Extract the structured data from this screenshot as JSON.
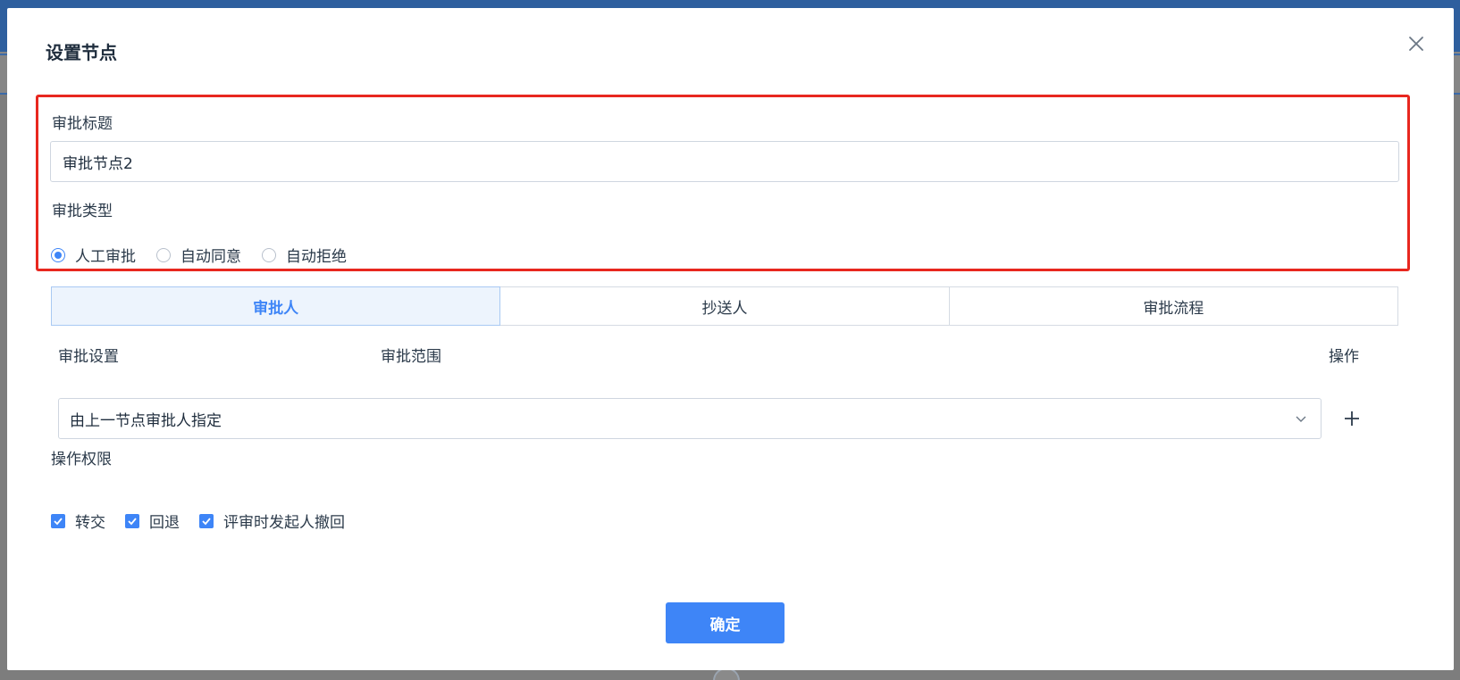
{
  "modal": {
    "title": "设置节点",
    "approval_title_label": "审批标题",
    "approval_title_value": "审批节点2",
    "approval_type_label": "审批类型",
    "approval_types": [
      {
        "label": "人工审批",
        "checked": true
      },
      {
        "label": "自动同意",
        "checked": false
      },
      {
        "label": "自动拒绝",
        "checked": false
      }
    ],
    "tabs": [
      {
        "label": "审批人",
        "active": true
      },
      {
        "label": "抄送人",
        "active": false
      },
      {
        "label": "审批流程",
        "active": false
      }
    ],
    "table_headers": {
      "setting": "审批设置",
      "scope": "审批范围",
      "action": "操作"
    },
    "approver_setting_value": "由上一节点审批人指定",
    "permissions_label": "操作权限",
    "permissions": [
      {
        "label": "转交",
        "checked": true
      },
      {
        "label": "回退",
        "checked": true
      },
      {
        "label": "评审时发起人撤回",
        "checked": true
      }
    ],
    "confirm_label": "确定"
  },
  "colors": {
    "accent": "#3e85f7",
    "highlight": "#e8271f"
  },
  "icons": {
    "close": "close-icon",
    "chevron": "chevron-down-icon",
    "add": "plus-icon",
    "check": "check-icon"
  }
}
